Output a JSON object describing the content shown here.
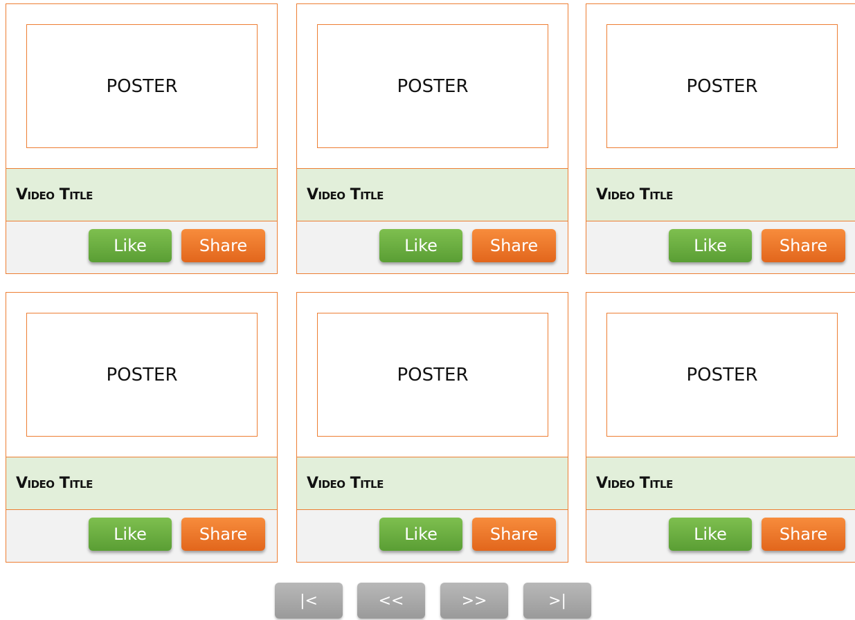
{
  "cards": [
    {
      "poster": "POSTER",
      "title": "Video Title",
      "like_label": "Like",
      "share_label": "Share"
    },
    {
      "poster": "POSTER",
      "title": "Video Title",
      "like_label": "Like",
      "share_label": "Share"
    },
    {
      "poster": "POSTER",
      "title": "Video Title",
      "like_label": "Like",
      "share_label": "Share"
    },
    {
      "poster": "POSTER",
      "title": "Video Title",
      "like_label": "Like",
      "share_label": "Share"
    },
    {
      "poster": "POSTER",
      "title": "Video Title",
      "like_label": "Like",
      "share_label": "Share"
    },
    {
      "poster": "POSTER",
      "title": "Video Title",
      "like_label": "Like",
      "share_label": "Share"
    }
  ],
  "pagination": {
    "first": "|<",
    "prev": "<<",
    "next": ">>",
    "last": ">|"
  },
  "colors": {
    "accent_border": "#ed7d31",
    "title_bg": "#e2efda",
    "action_bg": "#f2f2f2",
    "like_button": "#6aaf3e",
    "share_button": "#ed7d31",
    "pager_button": "#a6a6a6"
  }
}
